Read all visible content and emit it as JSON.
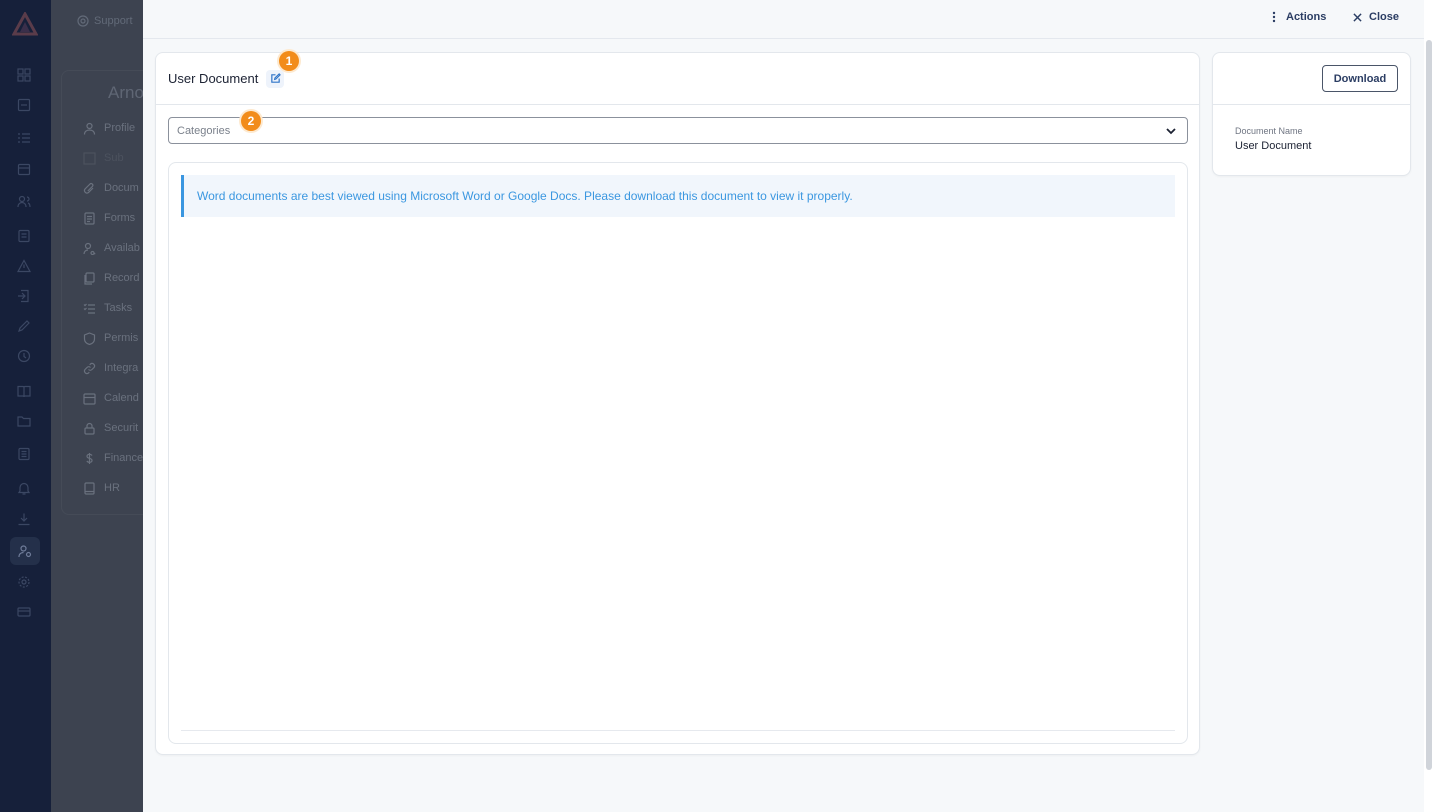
{
  "background_app": {
    "support_label": "Support",
    "page_title": "Arno",
    "nav_items": [
      {
        "label": "Profile",
        "icon": "user-icon"
      },
      {
        "label": "Sub",
        "icon": "grid-icon"
      },
      {
        "label": "Docum",
        "icon": "paperclip-icon"
      },
      {
        "label": "Forms",
        "icon": "form-icon"
      },
      {
        "label": "Availab",
        "icon": "user-search-icon"
      },
      {
        "label": "Record",
        "icon": "records-icon"
      },
      {
        "label": "Tasks",
        "icon": "tasks-icon"
      },
      {
        "label": "Permis",
        "icon": "shield-icon"
      },
      {
        "label": "Integra",
        "icon": "link-icon"
      },
      {
        "label": "Calend",
        "icon": "calendar-icon"
      },
      {
        "label": "Securit",
        "icon": "lock-icon"
      },
      {
        "label": "Finance",
        "icon": "dollar-icon"
      },
      {
        "label": "HR",
        "icon": "book-icon"
      }
    ]
  },
  "drawer": {
    "actions_label": "Actions",
    "close_label": "Close",
    "document": {
      "title": "User Document",
      "categories_placeholder": "Categories",
      "notice_text": "Word documents are best viewed using Microsoft Word or Google Docs. Please download this document to view it properly."
    },
    "info_panel": {
      "download_label": "Download",
      "field_label": "Document Name",
      "field_value": "User Document"
    },
    "badges": {
      "edit_step": "1",
      "categories_step": "2"
    }
  },
  "colors": {
    "accent": "#3b97e0",
    "badge": "#f28c1a",
    "button_text": "#2b3d63",
    "rail": "#16203a"
  }
}
